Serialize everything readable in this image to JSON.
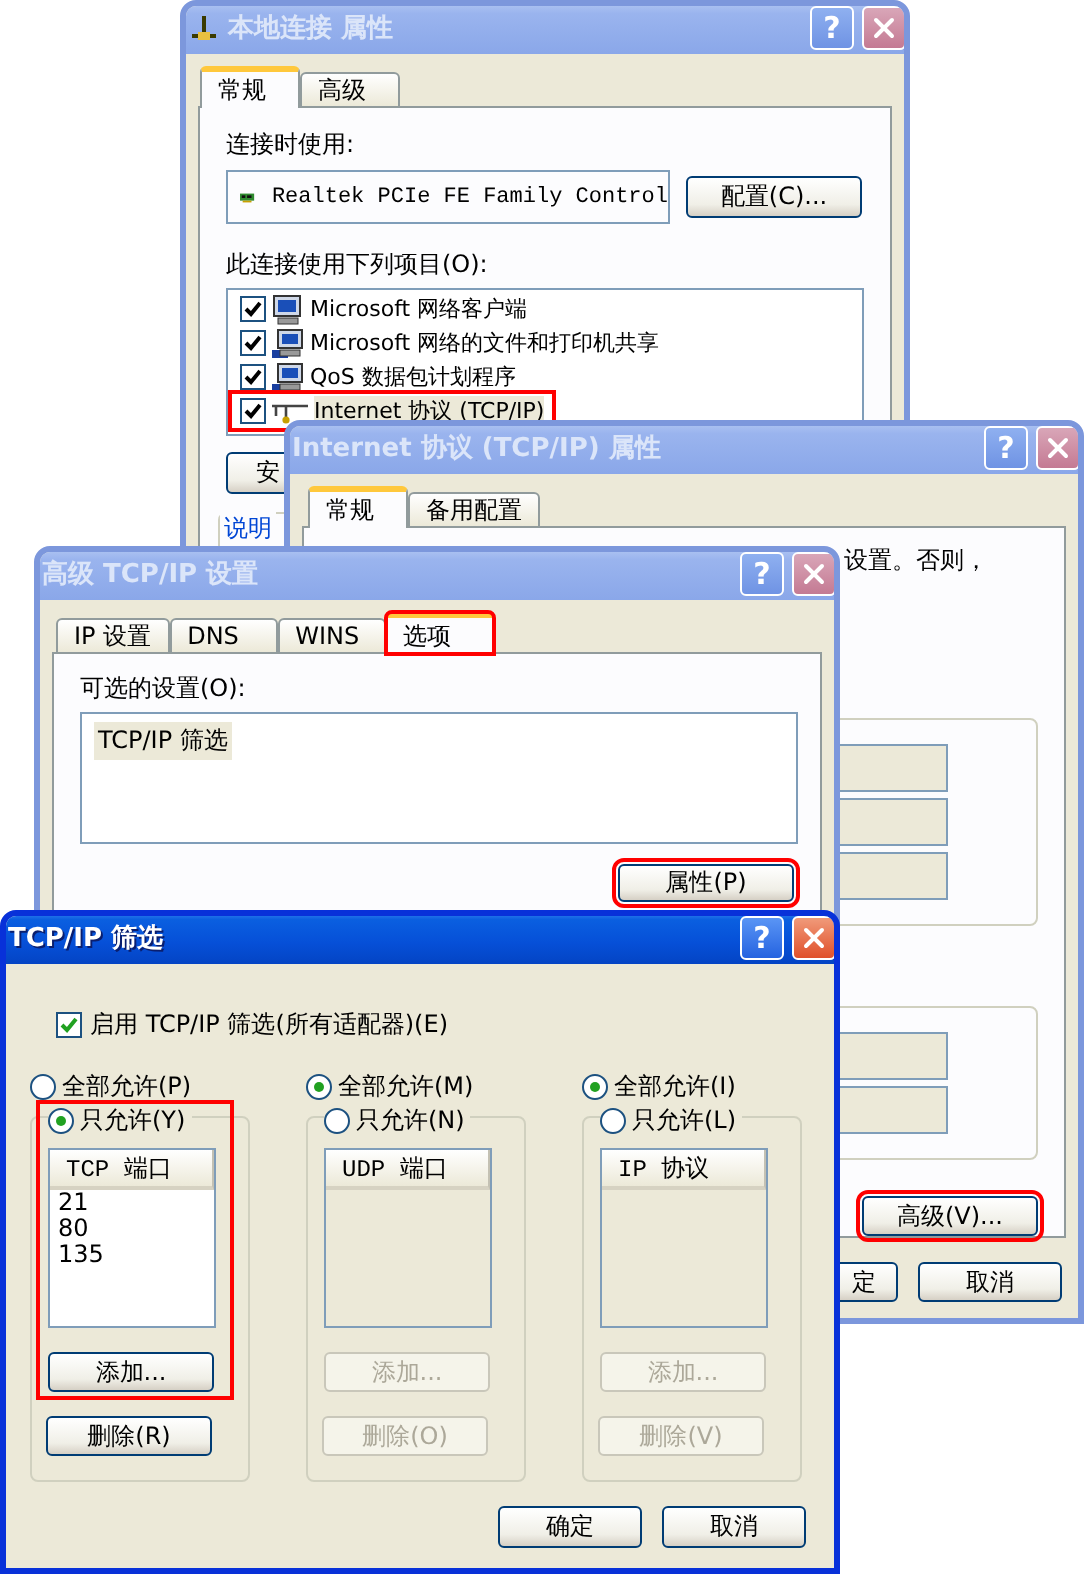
{
  "connection_window": {
    "title": "本地连接 属性",
    "active": false,
    "help": "?",
    "tabs": [
      {
        "label": "常规",
        "selected": true
      },
      {
        "label": "高级",
        "selected": false
      }
    ],
    "connect_using_label": "连接时使用:",
    "adapter": "Realtek PCIe FE Family Control",
    "configure_button": "配置(C)...",
    "components_label": "此连接使用下列项目(O):",
    "components": [
      {
        "label": "Microsoft 网络客户端",
        "checked": true,
        "highlighted": false,
        "kind": "client"
      },
      {
        "label": "Microsoft 网络的文件和打印机共享",
        "checked": true,
        "highlighted": false,
        "kind": "service"
      },
      {
        "label": "QoS 数据包计划程序",
        "checked": true,
        "highlighted": false,
        "kind": "service"
      },
      {
        "label": "Internet 协议 (TCP/IP)",
        "checked": true,
        "highlighted": true,
        "kind": "protocol"
      }
    ],
    "install_button": "安",
    "description_label": "说明"
  },
  "tcpip_window": {
    "title": "Internet 协议 (TCP/IP) 属性",
    "active": false,
    "help": "?",
    "tabs": [
      {
        "label": "常规",
        "selected": true
      },
      {
        "label": "备用配置",
        "selected": false
      }
    ],
    "info_text": "设置。否则，",
    "advanced_button": {
      "label": "高级(V)...",
      "highlighted": true
    },
    "ok_button": "定",
    "cancel_button": "取消"
  },
  "advanced_window": {
    "title": "高级 TCP/IP 设置",
    "active": false,
    "help": "?",
    "tabs": [
      {
        "label": "IP 设置",
        "selected": false,
        "highlighted": false
      },
      {
        "label": "DNS",
        "selected": false,
        "highlighted": false
      },
      {
        "label": "WINS",
        "selected": false,
        "highlighted": false
      },
      {
        "label": "选项",
        "selected": true,
        "highlighted": true
      }
    ],
    "optional_settings_label": "可选的设置(O):",
    "optional_settings": [
      {
        "label": "TCP/IP 筛选",
        "selected": true
      }
    ],
    "properties_button": {
      "label": "属性(P)",
      "highlighted": true
    }
  },
  "filter_window": {
    "title": "TCP/IP 筛选",
    "active": true,
    "help": "?",
    "enable_filtering": {
      "label": "启用 TCP/IP 筛选(所有适配器)(E)",
      "checked": true
    },
    "columns": [
      {
        "radios": [
          {
            "label": "全部允许(P)",
            "selected": false
          },
          {
            "label": "只允许(Y)",
            "selected": true
          }
        ],
        "list_header": "TCP 端口",
        "entries": [
          "21",
          "80",
          "135"
        ],
        "add_button": "添加...",
        "remove_button": "删除(R)",
        "highlighted": true
      },
      {
        "radios": [
          {
            "label": "全部允许(M)",
            "selected": true
          },
          {
            "label": "只允许(N)",
            "selected": false
          }
        ],
        "list_header": "UDP 端口",
        "add_button": "添加...",
        "remove_button": "删除(O)",
        "highlighted": false
      },
      {
        "radios": [
          {
            "label": "全部允许(I)",
            "selected": true
          },
          {
            "label": "只允许(L)",
            "selected": false
          }
        ],
        "list_header": "IP 协议",
        "add_button": "添加...",
        "remove_button": "删除(V)",
        "highlighted": false
      }
    ],
    "ok_button": "确定",
    "cancel_button": "取消"
  }
}
